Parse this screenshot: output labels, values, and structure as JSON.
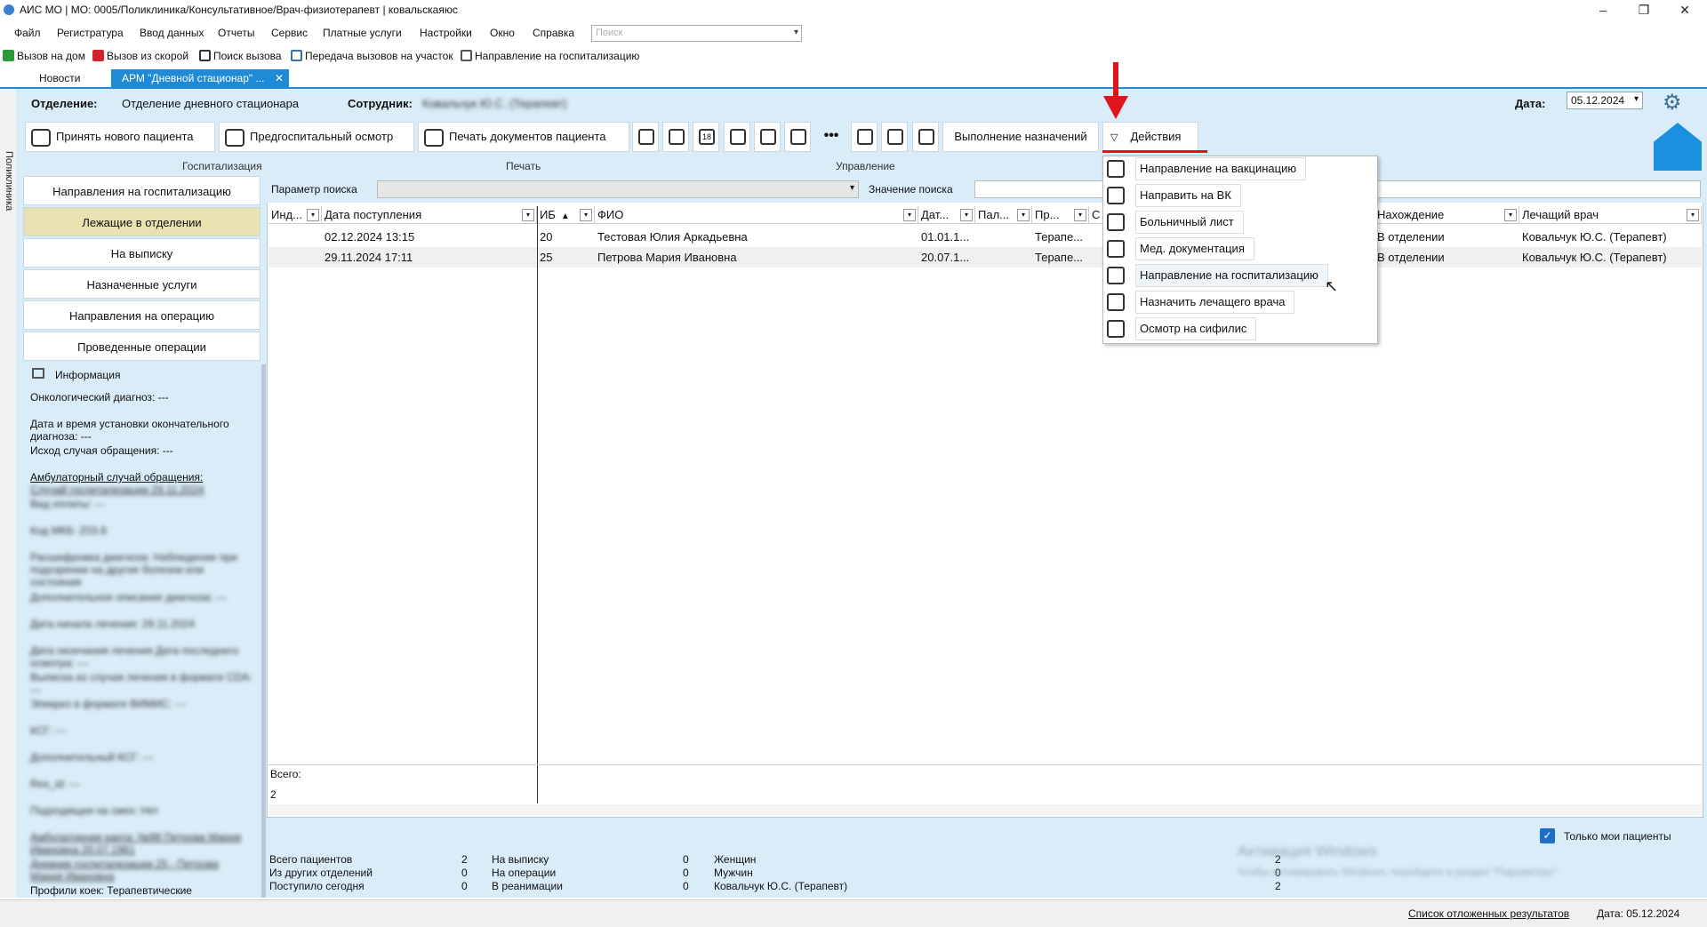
{
  "window": {
    "title": "АИС МО | МО: 0005/Поликлиника/Консультативное/Врач-физиотерапевт | ковальскаяюс",
    "minimize": "–",
    "maximize": "❐",
    "close": "✕"
  },
  "menu": [
    "Файл",
    "Регистратура",
    "Ввод данных",
    "Отчеты",
    "Сервис",
    "Платные услуги",
    "Настройки",
    "Окно",
    "Справка"
  ],
  "search": {
    "placeholder": "Поиск"
  },
  "quickbar": [
    "Вызов на дом",
    "Вызов из скорой",
    "Поиск вызова",
    "Передача вызовов на участок",
    "Направление на госпитализацию"
  ],
  "tabs": [
    {
      "label": "Новости"
    },
    {
      "label": "АРМ \"Дневной стационар\" ..."
    }
  ],
  "tab_close": "✕",
  "vertical_label": "Поликлиника",
  "header": {
    "dept_label": "Отделение:",
    "dept_value": "Отделение дневного стационара",
    "employee_label": "Сотрудник:",
    "employee_value": "Ковальчук Ю.С. (Терапевт)",
    "date_label": "Дата:",
    "date_value": "05.12.2024"
  },
  "toolbar": {
    "admit": "Принять нового пациента",
    "preexam": "Предгоспитальный осмотр",
    "print_docs": "Печать документов пациента",
    "more": "•••",
    "calendar_num": "18",
    "execute": "Выполнение назначений",
    "actions": "Действия"
  },
  "groups": {
    "hosp": "Госпитализация",
    "print": "Печать",
    "manage": "Управление"
  },
  "nav": [
    "Направления на госпитализацию",
    "Лежащие в отделении",
    "На выписку",
    "Назначенные услуги",
    "Направления на операцию",
    "Проведенные операции"
  ],
  "info": {
    "title": "Информация",
    "lines": [
      "Онкологический диагноз: ---",
      "Дата и время установки окончательного диагноза: ---",
      "Исход случая обращения: ---",
      "Амбулаторный случай обращения:",
      "Случай госпитализации 29.11.2024",
      "Вид оплаты: ---",
      "Код МКБ: Z03.8",
      "Расшифровка диагноза: Наблюдение при подозрении на другие болезни или состояния",
      "Дополнительное описание диагноза: ---",
      "Дата начала лечения: 29.11.2024",
      "Дата окончания лечения Дата последнего осмотра: ---",
      "Выписка из случая лечения в формате CDA: ---",
      "Эпикриз в формате ВИМИС: ---",
      "КСГ: ---",
      "Дополнительный КСГ: ---",
      "Res_id: ---",
      "Подходящая на смех: Нет",
      "Амбулаторная карта: №98 Петрова Мария Ивановна 20.07.1961",
      "Дневник госпитализации 25 - Петрова Мария Ивановна",
      "Профили коек: Терапевтические"
    ]
  },
  "search_row": {
    "param_label": "Параметр поиска",
    "value_label": "Значение поиска"
  },
  "columns": [
    "Инд...",
    "Дата поступления",
    "ИБ",
    "ФИО",
    "Дат...",
    "Пал...",
    "Пр...",
    "С",
    "Нахождение",
    "Лечащий врач"
  ],
  "rows": [
    {
      "date": "02.12.2024 13:15",
      "ib": "20",
      "fio": "Тестовая Юлия Аркадьевна",
      "dob": "01.01.1...",
      "pr": "Терапе...",
      "loc": "В отделении",
      "doctor": "Ковальчук Ю.С. (Терапевт)"
    },
    {
      "date": "29.11.2024 17:11",
      "ib": "25",
      "fio": "Петрова Мария Ивановна",
      "dob": "20.07.1...",
      "pr": "Терапе...",
      "loc": "В отделении",
      "doctor": "Ковальчук Ю.С. (Терапевт)"
    }
  ],
  "totals": {
    "label": "Всего:",
    "count": "2"
  },
  "dropdown": [
    "Направление на вакцинацию",
    "Направить на ВК",
    "Больничный лист",
    "Мед. документация",
    "Направление на госпитализацию",
    "Назначить лечащего врача",
    "Осмотр на сифилис"
  ],
  "only_mine": "Только мои пациенты",
  "stats": [
    {
      "label": "Всего пациентов",
      "value": "2"
    },
    {
      "label": "Из других отделений",
      "value": "0"
    },
    {
      "label": "Поступило сегодня",
      "value": "0"
    },
    {
      "label": "На выписку",
      "value": "0"
    },
    {
      "label": "На операции",
      "value": "0"
    },
    {
      "label": "В реанимации",
      "value": "0"
    },
    {
      "label": "Женщин",
      "value": "2"
    },
    {
      "label": "Мужчин",
      "value": "0"
    },
    {
      "label": "Ковальчук Ю.С. (Терапевт)",
      "value": "2"
    }
  ],
  "watermark": {
    "line1": "Активация Windows",
    "line2": "Чтобы активировать Windows, перейдите в раздел \"Параметры\"."
  },
  "status": {
    "deferred": "Список отложенных результатов",
    "date": "Дата: 05.12.2024"
  },
  "colors": {
    "accent": "#1f8bd6",
    "panel": "#d9ecf8",
    "active_nav": "#e8e2b0",
    "arrow": "#e0141b"
  }
}
